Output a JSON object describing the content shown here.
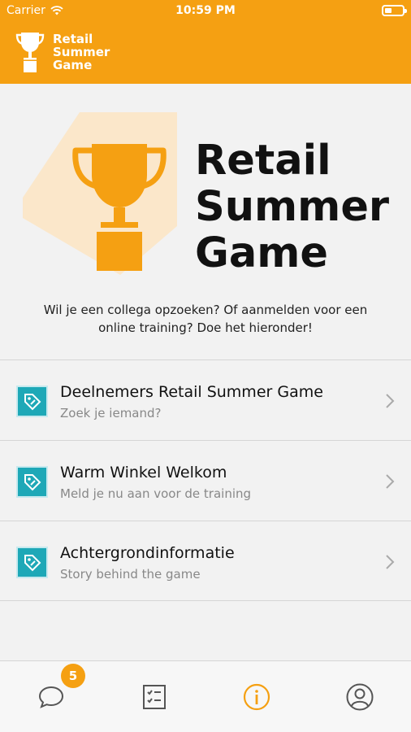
{
  "status_bar": {
    "carrier": "Carrier",
    "time": "10:59 PM"
  },
  "app_bar": {
    "logo_lines": [
      "Retail",
      "Summer",
      "Game"
    ],
    "background_color": "#f5a012"
  },
  "hero": {
    "title_lines": [
      "Retail",
      "Summer",
      "Game"
    ],
    "trophy_color": "#f5a012"
  },
  "intro_text": "Wil je een collega opzoeken? Of aanmelden voor een online training? Doe het hieronder!",
  "menu": {
    "items": [
      {
        "title": "Deelnemers Retail Summer Game",
        "subtitle": "Zoek je iemand?",
        "icon": "tag-icon"
      },
      {
        "title": "Warm Winkel Welkom",
        "subtitle": "Meld je nu aan voor de training",
        "icon": "tag-icon"
      },
      {
        "title": "Achtergrondinformatie",
        "subtitle": "Story behind the game",
        "icon": "tag-icon"
      }
    ],
    "icon_color": "#1ea8b7"
  },
  "tab_bar": {
    "tabs": [
      {
        "icon": "chat-icon",
        "badge": "5"
      },
      {
        "icon": "checklist-icon"
      },
      {
        "icon": "info-icon",
        "active": true
      },
      {
        "icon": "profile-icon"
      }
    ],
    "active_color": "#f5a012"
  }
}
